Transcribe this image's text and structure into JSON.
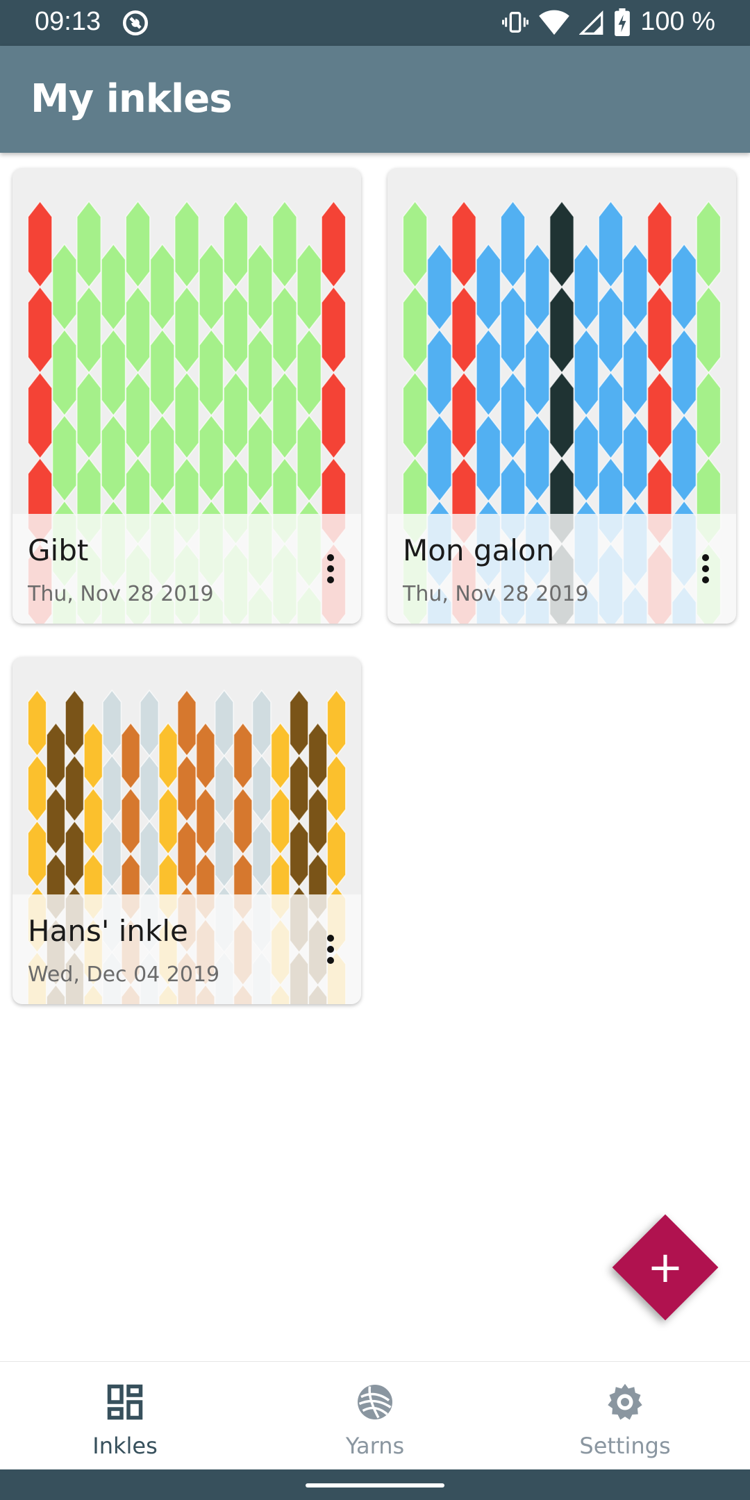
{
  "status_bar": {
    "time": "09:13",
    "battery": "100 %",
    "icons": [
      "dnd-icon",
      "vibrate-icon",
      "wifi-icon",
      "cell-signal-icon",
      "battery-charging-icon"
    ]
  },
  "app_bar": {
    "title": "My inkles"
  },
  "inkles": [
    {
      "name": "Gibt",
      "date": "Thu, Nov 28 2019",
      "colors": {
        "R": "#f44336",
        "G": "#a5f08a"
      },
      "threads": "RGGGGGGGGGGGR"
    },
    {
      "name": "Mon galon",
      "date": "Thu, Nov 28 2019",
      "colors": {
        "G": "#a5f08a",
        "B": "#52b0f2",
        "R": "#f44336",
        "D": "#1f3333"
      },
      "threads": "GBRBBBDBBBRBG"
    },
    {
      "name": "Hans' inkle",
      "date": "Wed, Dec 04 2019",
      "colors": {
        "Y": "#fbc02d",
        "K": "#7a5418",
        "S": "#d0dce0",
        "O": "#d6782e"
      },
      "threads": "YKKYSOSYOOSOSYKKY"
    }
  ],
  "fab": {
    "label": "+"
  },
  "bottom_nav": {
    "items": [
      {
        "label": "Inkles",
        "icon": "dashboard-icon",
        "active": true
      },
      {
        "label": "Yarns",
        "icon": "yarn-ball-icon",
        "active": false
      },
      {
        "label": "Settings",
        "icon": "gear-icon",
        "active": false
      }
    ]
  },
  "theme": {
    "primary": "#607d8b",
    "status": "#37505c",
    "accent": "#b0124f"
  }
}
